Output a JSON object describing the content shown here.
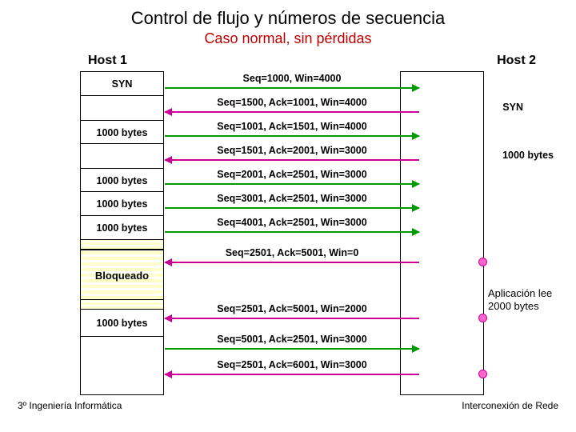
{
  "title": "Control de flujo y números de secuencia",
  "subtitle": "Caso normal, sin pérdidas",
  "host1_label": "Host 1",
  "host2_label": "Host 2",
  "left_col": {
    "r0": "SYN",
    "r1": "1000 bytes",
    "r2": "1000 bytes",
    "r3": "1000 bytes",
    "r4": "1000 bytes",
    "r5": "Bloqueado",
    "r6": "1000 bytes"
  },
  "right_col": {
    "r0": "SYN",
    "r1": "1000 bytes"
  },
  "right_note": "Aplicación lee 2000 bytes",
  "messages": [
    "Seq=1000, Win=4000",
    "Seq=1500, Ack=1001, Win=4000",
    "Seq=1001, Ack=1501, Win=4000",
    "Seq=1501, Ack=2001, Win=3000",
    "Seq=2001, Ack=2501, Win=3000",
    "Seq=3001, Ack=2501, Win=3000",
    "Seq=4001, Ack=2501, Win=3000",
    "Seq=2501, Ack=5001, Win=0",
    "Seq=2501, Ack=5001, Win=2000",
    "Seq=5001, Ack=2501, Win=3000",
    "Seq=2501, Ack=6001, Win=3000"
  ],
  "footer_left": "3º Ingeniería Informática",
  "footer_right": "Interconexión de Rede"
}
